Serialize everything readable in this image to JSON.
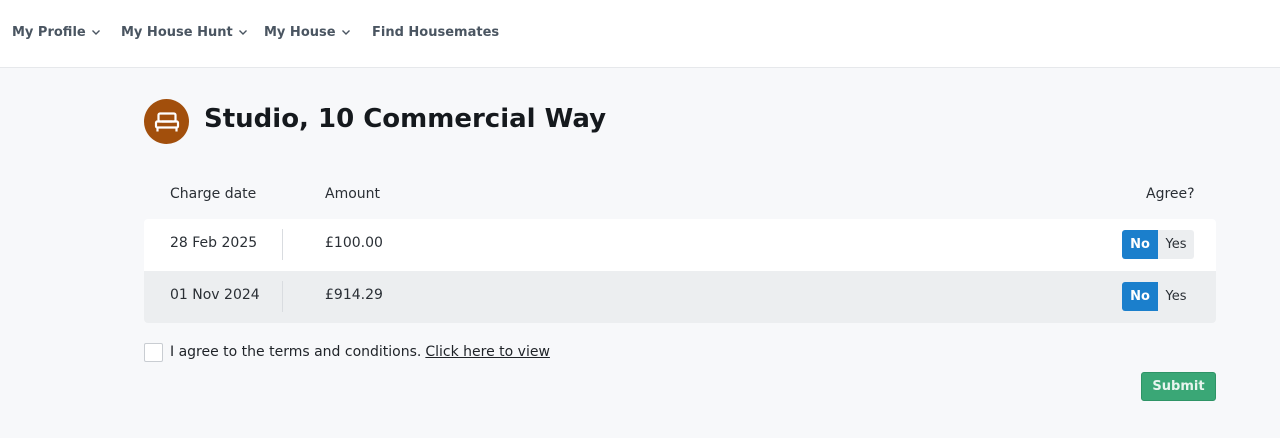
{
  "nav": {
    "items": [
      {
        "label": "My Profile",
        "has_dropdown": true
      },
      {
        "label": "My House Hunt",
        "has_dropdown": true
      },
      {
        "label": "My House",
        "has_dropdown": true
      },
      {
        "label": "Find Housemates",
        "has_dropdown": false
      }
    ]
  },
  "page": {
    "icon": "bed-icon",
    "icon_color": "#a24f0c",
    "title": "Studio, 10 Commercial Way"
  },
  "table": {
    "headers": {
      "charge_date": "Charge date",
      "amount": "Amount",
      "agree": "Agree?"
    },
    "rows": [
      {
        "charge_date": "28 Feb 2025",
        "amount": "£100.00",
        "no_label": "No",
        "yes_label": "Yes",
        "selected": "No"
      },
      {
        "charge_date": "01 Nov 2024",
        "amount": "£914.29",
        "no_label": "No",
        "yes_label": "Yes",
        "selected": "No"
      }
    ]
  },
  "terms": {
    "checked": false,
    "text": "I agree to the terms and conditions.",
    "link": "Click here to view"
  },
  "submit": {
    "label": "Submit",
    "color": "#3aa776"
  },
  "colors": {
    "accent": "#1b7fcc",
    "background": "#f7f8fa"
  }
}
